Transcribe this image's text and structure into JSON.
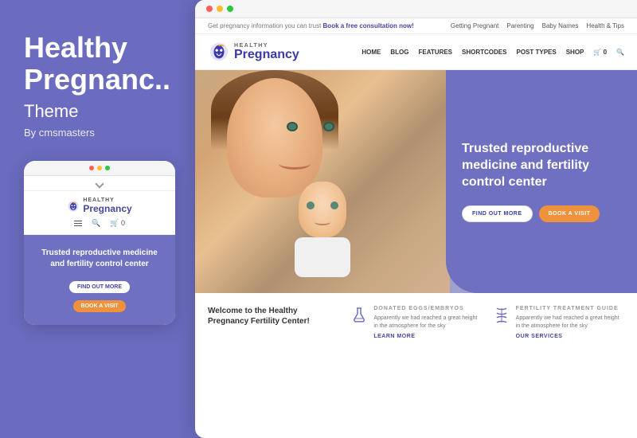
{
  "left": {
    "title": "Healthy Pregnанс..",
    "title_line1": "Healthy",
    "title_line2": "Pregnanc..",
    "subtitle": "Theme",
    "by": "By cmsmasters"
  },
  "mobile_mockup": {
    "logo_healthy": "HEALTHY",
    "logo_pregnancy": "Pregnancy",
    "hero_text": "Trusted reproductive medicine and fertility control center",
    "btn_find": "FIND OUT MORE",
    "btn_book": "BOOK A VISIT"
  },
  "desktop": {
    "promo_text": "Get pregnancy information you can trust",
    "promo_link": "Book a free consultation now!",
    "nav_links": [
      "HOME",
      "BLOG",
      "FEATURES",
      "SHORTCODES",
      "POST TYPES",
      "SHOP"
    ],
    "logo_healthy": "HEALTHY",
    "logo_pregnancy": "Pregnancy",
    "top_nav": [
      "Getting Pregnant",
      "Parenting",
      "Baby Names",
      "Health & Tips"
    ],
    "hero_heading": "Trusted reproductive medicine and fertility control center",
    "btn_find_out": "FIND OUT MORE",
    "btn_book_visit": "BOOK A VISIT",
    "bottom_welcome": "Welcome to the Healthy Pregnancy Fertility Center!",
    "bottom_col2_label": "DONATED EGGS/EMBRYOS",
    "bottom_col2_desc": "Apparently we had reached a great height in the atmosphere for the sky",
    "bottom_col2_link": "LEARN MORE",
    "bottom_col3_label": "FERTILITY TREATMENT GUIDE",
    "bottom_col3_desc": "Apparently we had reached a great height in the atmosphere for the sky",
    "bottom_col3_link": "OUR SERVICES"
  },
  "colors": {
    "purple": "#6b6bbf",
    "dark_purple": "#3a3aaa",
    "orange": "#f0923c",
    "white": "#ffffff"
  }
}
